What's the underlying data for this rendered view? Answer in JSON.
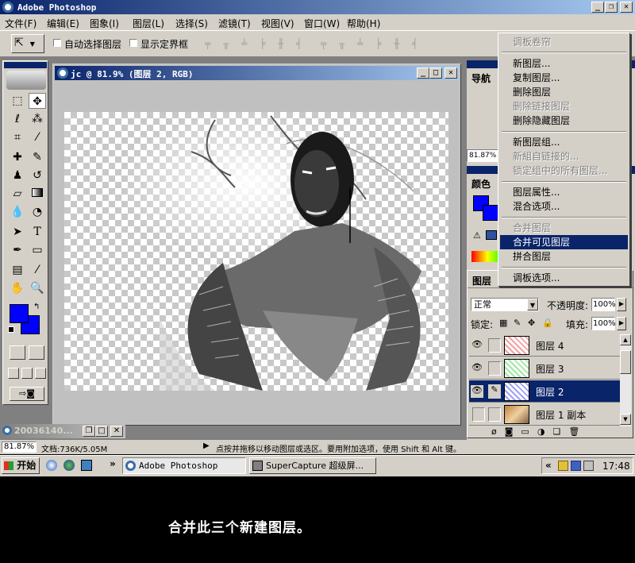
{
  "app": {
    "title": "Adobe Photoshop"
  },
  "menubar": {
    "items": [
      "文件(F)",
      "编辑(E)",
      "图象(I)",
      "图层(L)",
      "选择(S)",
      "滤镜(T)",
      "视图(V)",
      "窗口(W)",
      "帮助(H)"
    ]
  },
  "options": {
    "auto_select": "自动选择图层",
    "show_bounds": "显示定界框"
  },
  "document": {
    "title": "jc @ 81.9% (图层 2, RGB)"
  },
  "navigator": {
    "tab": "导航",
    "zoom": "81.87%"
  },
  "color_panel": {
    "tab": "颜色"
  },
  "layers": {
    "tab": "图层",
    "blend_mode": "正常",
    "opacity_label": "不透明度:",
    "opacity": "100%",
    "lock_label": "锁定:",
    "fill_label": "填充:",
    "fill": "100%",
    "rows": [
      {
        "name": "图层 4",
        "selected": false
      },
      {
        "name": "图层 3",
        "selected": false
      },
      {
        "name": "图层 2",
        "selected": true
      },
      {
        "name": "图层 1 副本",
        "selected": false
      }
    ]
  },
  "context_menu": {
    "items": [
      {
        "label": "调板卷帘",
        "disabled": true
      },
      {
        "label": "新图层...",
        "disabled": false
      },
      {
        "label": "复制图层...",
        "disabled": false
      },
      {
        "label": "删除图层",
        "disabled": false
      },
      {
        "label": "删除链接图层",
        "disabled": true
      },
      {
        "label": "删除隐藏图层",
        "disabled": false
      },
      {
        "label": "新图层组...",
        "disabled": false
      },
      {
        "label": "新組自链接的...",
        "disabled": true
      },
      {
        "label": "锁定组中的所有图层...",
        "disabled": true
      },
      {
        "label": "图层属性...",
        "disabled": false
      },
      {
        "label": "混合选项...",
        "disabled": false
      },
      {
        "label": "合并图层",
        "disabled": true
      },
      {
        "label": "合并可见图层",
        "disabled": false,
        "highlighted": true
      },
      {
        "label": "拼合图层",
        "disabled": false
      },
      {
        "label": "调板选项...",
        "disabled": false
      }
    ]
  },
  "minimized_window": {
    "title": "20036140..."
  },
  "status": {
    "zoom": "81.87%",
    "doc_info": "文档:736K/5.05M",
    "hint": "点按并拖移以移动图层或选区。要用附加选项，使用 Shift 和 Alt 键。"
  },
  "taskbar": {
    "start": "开始",
    "tasks": [
      "Adobe Photoshop",
      "SuperCapture 超级屏..."
    ],
    "clock": "17:48",
    "chevrons": "»",
    "tray_chevrons": "«"
  },
  "caption": "合并此三个新建图层。",
  "colors": {
    "foreground": "#0000ff",
    "background": "#0000ff",
    "selection": "#0a246a",
    "titlebar": "#0a246a"
  }
}
